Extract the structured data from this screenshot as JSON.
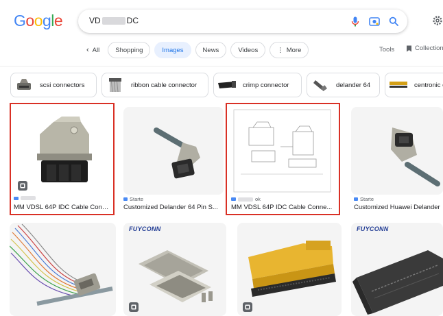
{
  "header": {
    "logo_letters": [
      {
        "ch": "G",
        "color": "#4285F4"
      },
      {
        "ch": "o",
        "color": "#EA4335"
      },
      {
        "ch": "o",
        "color": "#FBBC05"
      },
      {
        "ch": "g",
        "color": "#4285F4"
      },
      {
        "ch": "l",
        "color": "#34A853"
      },
      {
        "ch": "e",
        "color": "#EA4335"
      }
    ],
    "search": {
      "prefix": "VD",
      "suffix": "DC",
      "icons": [
        "mic-icon",
        "camera-lens-icon",
        "search-icon"
      ]
    },
    "settings_icon": "gear-icon"
  },
  "tabs": {
    "back": "All",
    "items": [
      {
        "label": "Shopping",
        "active": false
      },
      {
        "label": "Images",
        "active": true
      },
      {
        "label": "News",
        "active": false
      },
      {
        "label": "Videos",
        "active": false
      },
      {
        "label": "More",
        "active": false
      }
    ],
    "tools": "Tools",
    "collections": "Collection"
  },
  "related_chips": [
    {
      "label": "scsi connectors"
    },
    {
      "label": "ribbon cable connector"
    },
    {
      "label": "crimp connector"
    },
    {
      "label": "delander 64"
    },
    {
      "label": "centronic c"
    }
  ],
  "results": {
    "row1": [
      {
        "source": "",
        "caption": "MM VDSL 64P IDC Cable Conn...",
        "highlighted": true
      },
      {
        "source": "Starte",
        "caption": "Customized Delander 64 Pin S...",
        "highlighted": false
      },
      {
        "source": "ok",
        "caption": "MM VDSL 64P IDC Cable Conne...",
        "highlighted": true
      },
      {
        "source": "Starte",
        "caption": "Customized Huawei Delander",
        "highlighted": false
      }
    ],
    "row2_brands": [
      "FUYCONN",
      "FUYCONN"
    ]
  },
  "colors": {
    "accent": "#1a73e8",
    "highlight": "#d93025"
  }
}
